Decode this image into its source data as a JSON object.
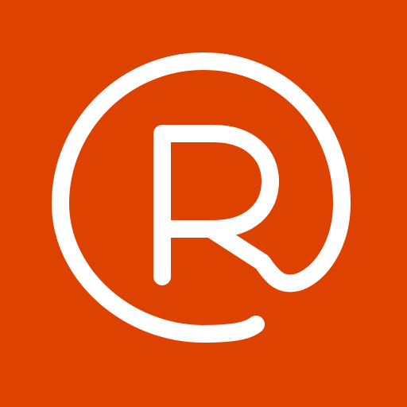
{
  "app_icon": {
    "glyph": "circled-r-logo",
    "background_color": "#DD4200",
    "glyph_color": "#FFFFFF"
  }
}
